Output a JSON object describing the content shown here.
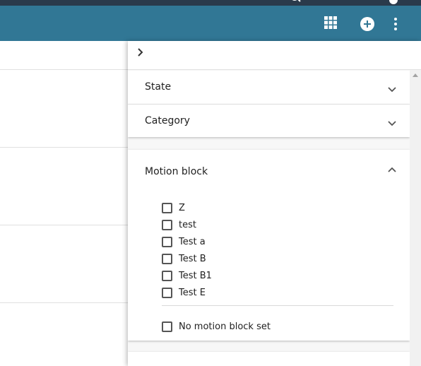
{
  "filter_panel": {
    "sections": [
      {
        "title": "State",
        "expanded": false
      },
      {
        "title": "Category",
        "expanded": false
      },
      {
        "title": "Motion block",
        "expanded": true
      }
    ],
    "motion_block_options": [
      "Z",
      "test",
      "Test a",
      "Test B",
      "Test B1",
      "Test E"
    ],
    "no_motion_block_option": "No motion block set"
  },
  "toolbar": {
    "icons": [
      "grid-view-icon",
      "add-circle-icon",
      "more-vert-icon"
    ]
  },
  "colors": {
    "toolbar": "#317795",
    "top_strip": "#2a3a4b"
  }
}
